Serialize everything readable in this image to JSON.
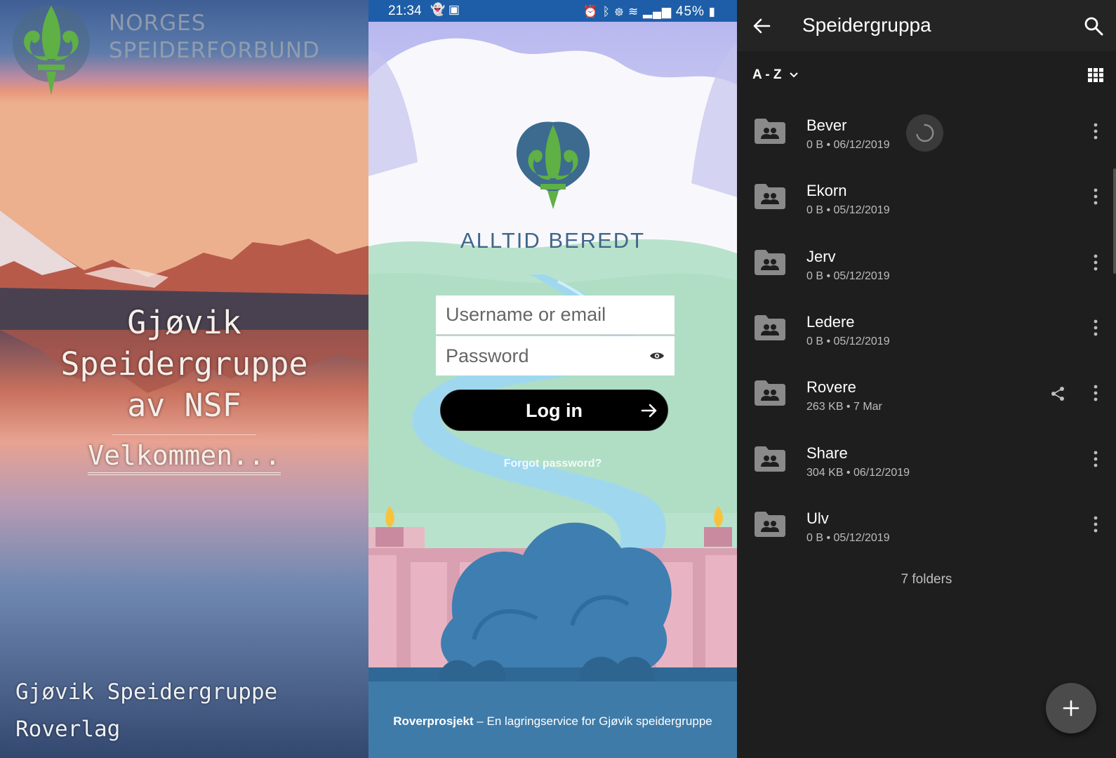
{
  "splash": {
    "org_line1": "NORGES",
    "org_line2": "SPEIDERFORBUND",
    "title_line1": "Gjøvik",
    "title_line2": "Speidergruppe",
    "title_line3": "av NSF",
    "welcome": "Velkommen...",
    "footer_line1": "Gjøvik Speidergruppe",
    "footer_line2": "Roverlag"
  },
  "status_bar": {
    "time": "21:34",
    "battery": "45%",
    "icons_left": [
      "ghost-icon",
      "gallery-icon"
    ],
    "icons_right": [
      "alarm-icon",
      "bluetooth-icon",
      "volte-icon",
      "wifi-icon",
      "signal-icon",
      "battery-icon"
    ]
  },
  "login": {
    "motto": "ALLTID BEREDT",
    "username_placeholder": "Username or email",
    "password_placeholder": "Password",
    "login_label": "Log in",
    "forgot_label": "Forgot password?",
    "footer_brand": "Roverprosjekt",
    "footer_text": " – En lagringservice for Gjøvik speidergruppe"
  },
  "files": {
    "title": "Speidergruppa",
    "sort_label": "A - Z",
    "folders": [
      {
        "name": "Bever",
        "size": "0 B",
        "date": "06/12/2019",
        "loading": true,
        "shared": false
      },
      {
        "name": "Ekorn",
        "size": "0 B",
        "date": "05/12/2019",
        "loading": false,
        "shared": false
      },
      {
        "name": "Jerv",
        "size": "0 B",
        "date": "05/12/2019",
        "loading": false,
        "shared": false
      },
      {
        "name": "Ledere",
        "size": "0 B",
        "date": "05/12/2019",
        "loading": false,
        "shared": false
      },
      {
        "name": "Rovere",
        "size": "263 KB",
        "date": "7 Mar",
        "loading": false,
        "shared": true
      },
      {
        "name": "Share",
        "size": "304 KB",
        "date": "06/12/2019",
        "loading": false,
        "shared": false
      },
      {
        "name": "Ulv",
        "size": "0 B",
        "date": "05/12/2019",
        "loading": false,
        "shared": false
      }
    ],
    "folder_count_label": "7 folders"
  },
  "colors": {
    "status_bar": "#1e5ea8",
    "logo_blue": "#3c6b8f",
    "logo_green": "#5fb045",
    "dark_bg": "#1e1e1e",
    "appbar_bg": "#242424"
  }
}
